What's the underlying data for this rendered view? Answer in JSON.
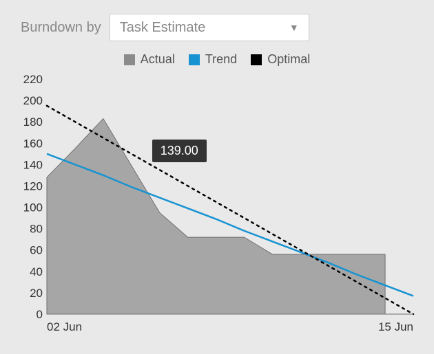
{
  "controls": {
    "burndown_by_label": "Burndown by",
    "select_value": "Task Estimate"
  },
  "legend": {
    "actual": "Actual",
    "trend": "Trend",
    "optimal": "Optimal"
  },
  "tooltip_value": "139.00",
  "chart_data": {
    "type": "area",
    "title": "",
    "xlabel": "",
    "ylabel": "",
    "ylim": [
      0,
      220
    ],
    "y_ticks": [
      0,
      20,
      40,
      60,
      80,
      100,
      120,
      140,
      160,
      180,
      200,
      220
    ],
    "x_tick_labels": [
      "02 Jun",
      "15 Jun"
    ],
    "x": [
      0,
      1,
      2,
      3,
      4,
      5,
      6,
      7,
      8,
      9,
      10,
      11,
      12,
      13
    ],
    "series": [
      {
        "name": "Actual",
        "type": "area",
        "values": [
          128,
          155,
          183,
          139,
          95,
          72,
          72,
          72,
          56,
          56,
          56,
          56,
          56,
          null
        ]
      },
      {
        "name": "Trend",
        "type": "line",
        "values": [
          150,
          140,
          130,
          119,
          109,
          99,
          89,
          78,
          68,
          58,
          48,
          37,
          27,
          17
        ]
      },
      {
        "name": "Optimal",
        "type": "dotted",
        "values": [
          195,
          180,
          165,
          150,
          135,
          120,
          105,
          90,
          75,
          60,
          45,
          30,
          15,
          0
        ]
      }
    ],
    "tooltip": {
      "x": 3,
      "value": 139.0
    }
  },
  "colors": {
    "actual": "#9a9a9a",
    "trend": "#1793d1",
    "optimal": "#000000"
  }
}
